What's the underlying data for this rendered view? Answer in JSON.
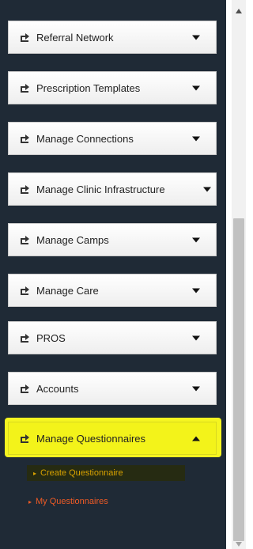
{
  "menu": {
    "items": [
      {
        "label": "Referral Network",
        "icon": "share-icon",
        "caret": "chevron-down-icon"
      },
      {
        "label": "Prescription Templates",
        "icon": "share-icon",
        "caret": "chevron-down-icon"
      },
      {
        "label": "Manage Connections",
        "icon": "share-icon",
        "caret": "chevron-down-icon"
      },
      {
        "label": "Manage Clinic Infrastructure",
        "icon": "share-icon",
        "caret": "chevron-down-icon"
      },
      {
        "label": "Manage Camps",
        "icon": "share-icon",
        "caret": "chevron-down-icon"
      },
      {
        "label": "Manage Care",
        "icon": "share-icon",
        "caret": "chevron-down-icon"
      },
      {
        "label": "PROS",
        "icon": "share-icon",
        "caret": "chevron-down-icon"
      },
      {
        "label": "Accounts",
        "icon": "share-icon",
        "caret": "chevron-down-icon"
      },
      {
        "label": "Manage Questionnaires",
        "icon": "share-icon",
        "caret": "chevron-up-icon",
        "expanded": true
      }
    ],
    "submenu": {
      "create": "Create Questionnaire",
      "my": "My Questionnaires"
    }
  },
  "colors": {
    "sidebar_bg": "#1f2a36",
    "highlight": "#f5f520",
    "submenu_create": "#d8a200",
    "submenu_my": "#ef5b25"
  }
}
